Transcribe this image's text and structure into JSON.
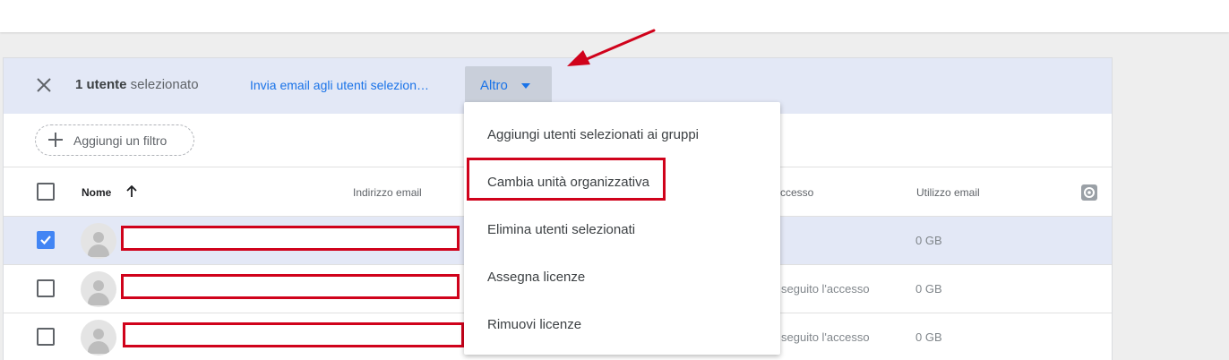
{
  "selection_bar": {
    "count_bold": "1 utente",
    "count_rest": " selezionato",
    "send_email": "Invia email agli utenti selezion…",
    "more_button": "Altro"
  },
  "filter": {
    "add_filter": "Aggiungi un filtro"
  },
  "table": {
    "headers": {
      "name": "Nome",
      "email": "Indirizzo email",
      "last_access": "ccesso",
      "email_usage": "Utilizzo email"
    },
    "rows": [
      {
        "checked": true,
        "last_access": "",
        "usage": "0 GB"
      },
      {
        "checked": false,
        "last_access": "seguito l'accesso",
        "usage": "0 GB"
      },
      {
        "checked": false,
        "last_access": "seguito l'accesso",
        "usage": "0 GB"
      }
    ]
  },
  "menu": {
    "items": [
      "Aggiungi utenti selezionati ai gruppi",
      "Cambia unità organizzativa",
      "Elimina utenti selezionati",
      "Assegna licenze",
      "Rimuovi licenze"
    ]
  },
  "colors": {
    "accent": "#1a73e8",
    "annotation": "#d0021b",
    "selected_row": "#e3e8f6"
  },
  "icons": [
    "close-icon",
    "plus-icon",
    "sort-up-icon",
    "gear-icon",
    "check-icon",
    "avatar-icon",
    "caret-down-icon",
    "annotation-arrow"
  ]
}
